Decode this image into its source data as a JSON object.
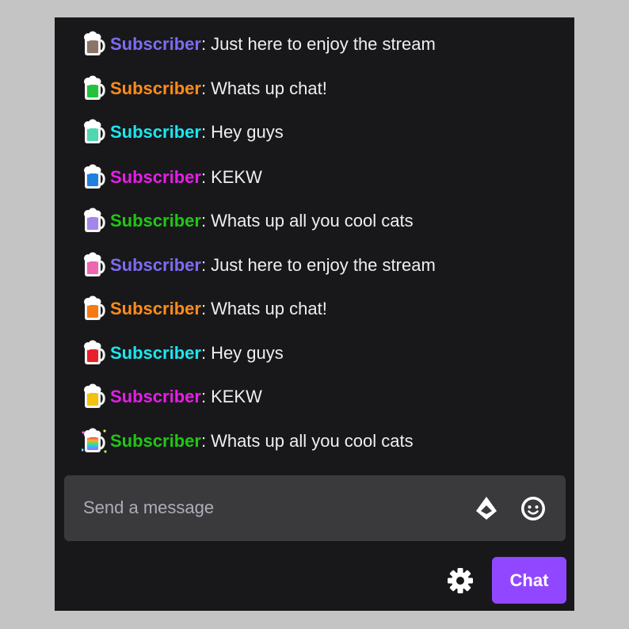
{
  "messages": [
    {
      "username": "Subscriber",
      "name_color": "#7c6cf0",
      "separator": ":",
      "text": "Just here to enjoy the stream",
      "badge": "beer-mug-badge-icon",
      "liquid": "#8a7468"
    },
    {
      "username": "Subscriber",
      "name_color": "#ff8c1a",
      "separator": ":",
      "text": "Whats up chat!",
      "badge": "beer-mug-badge-icon",
      "liquid": "#22c33a"
    },
    {
      "username": "Subscriber",
      "name_color": "#1ee6ee",
      "separator": ":",
      "text": "Hey guys",
      "badge": "beer-mug-badge-icon",
      "liquid": "#4fd6b2"
    },
    {
      "username": "Subscriber",
      "name_color": "#e61ee6",
      "separator": ":",
      "text": "KEKW",
      "badge": "beer-mug-badge-icon",
      "liquid": "#1f7fe0"
    },
    {
      "username": "Subscriber",
      "name_color": "#22c516",
      "separator": ":",
      "text": "Whats up all you cool cats",
      "badge": "beer-mug-badge-icon",
      "liquid": "#a585ea"
    },
    {
      "username": "Subscriber",
      "name_color": "#7c6cf0",
      "separator": ":",
      "text": "Just here to enjoy the stream",
      "badge": "beer-mug-badge-icon",
      "liquid": "#ee66b0"
    },
    {
      "username": "Subscriber",
      "name_color": "#ff8c1a",
      "separator": ":",
      "text": "Whats up chat!",
      "badge": "beer-mug-badge-icon",
      "liquid": "#f57a14"
    },
    {
      "username": "Subscriber",
      "name_color": "#1ee6ee",
      "separator": ":",
      "text": "Hey guys",
      "badge": "beer-mug-badge-icon",
      "liquid": "#e8202a"
    },
    {
      "username": "Subscriber",
      "name_color": "#e61ee6",
      "separator": ":",
      "text": "KEKW",
      "badge": "beer-mug-badge-icon",
      "liquid": "#f2c20f"
    },
    {
      "username": "Subscriber",
      "name_color": "#22c516",
      "separator": ":",
      "text": "Whats up all you cool cats",
      "badge": "rainbow-beer-mug-badge-icon",
      "liquid": "rainbow"
    }
  ],
  "input": {
    "placeholder": "Send a message",
    "value": "",
    "bits_icon": "bits-icon",
    "emote_icon": "smiley-face-icon"
  },
  "footer": {
    "settings_icon": "gear-icon",
    "chat_button_label": "Chat"
  },
  "colors": {
    "panel_background": "#18181b",
    "input_background": "#3a3a3d",
    "accent": "#9147ff",
    "text": "#efeff1",
    "placeholder": "#adadb8"
  }
}
